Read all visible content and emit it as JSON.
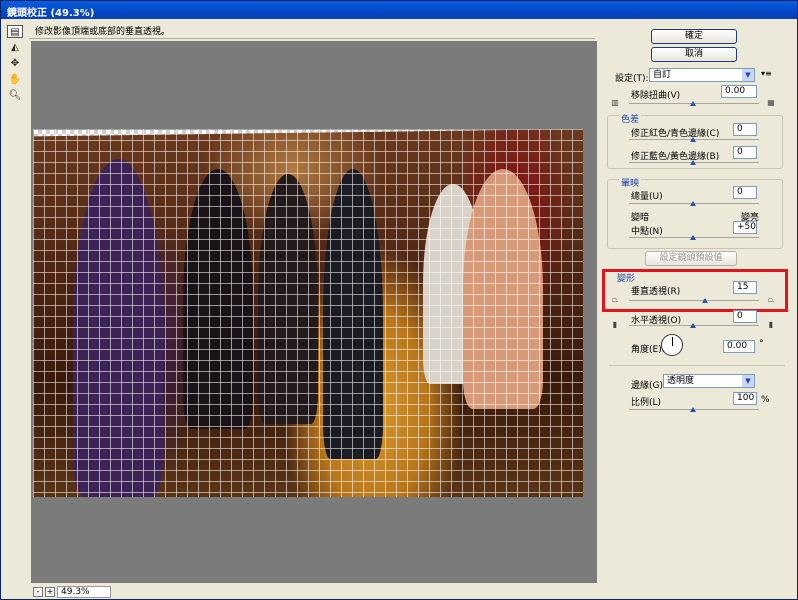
{
  "window": {
    "title": "鏡頭校正 (49.3%)"
  },
  "hint": "修改影像頂端或底部的垂直透視。",
  "toolbar": {
    "tools": [
      "remove-distortion-tool",
      "straighten-tool",
      "move-grid-tool",
      "hand-tool",
      "zoom-tool"
    ]
  },
  "status": {
    "zoom": "49.3%",
    "minus": "-",
    "plus": "+"
  },
  "buttons": {
    "ok": "確定",
    "cancel": "取消",
    "set_default": "設定鏡頭預設值"
  },
  "settings": {
    "label": "設定(T):",
    "value": "自訂",
    "menu": "▾≡"
  },
  "remove_distortion": {
    "label": "移除扭曲(V)",
    "value": "0.00"
  },
  "chromatic": {
    "title": "色差",
    "red_cyan_label": "修正紅色/青色邊緣(C)",
    "red_cyan_value": "0",
    "blue_yellow_label": "修正藍色/黃色邊緣(B)",
    "blue_yellow_value": "0"
  },
  "vignette": {
    "title": "暈映",
    "amount_label": "總量(U)",
    "amount_value": "0",
    "darken": "變暗",
    "lighten": "變亮",
    "midpoint_label": "中點(N)",
    "midpoint_value": "+50"
  },
  "transform": {
    "title": "變形",
    "vertical_label": "垂直透視(R)",
    "vertical_value": "15",
    "horizontal_label": "水平透視(O)",
    "horizontal_value": "0",
    "angle_label": "角度(E):",
    "angle_value": "0.00",
    "degree": "°",
    "edge_label": "邊緣(G):",
    "edge_value": "透明度",
    "scale_label": "比例(L)",
    "scale_value": "100",
    "percent": "%"
  },
  "colors": {
    "titlebar": "#0a5ee0",
    "highlight": "#e0141c",
    "group_title": "#1b46a8"
  }
}
